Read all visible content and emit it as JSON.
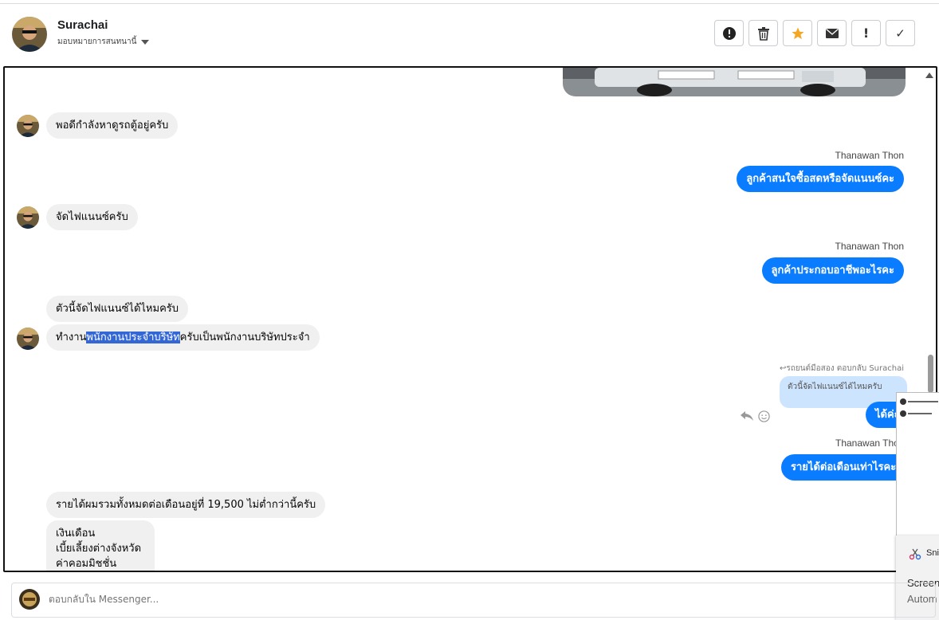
{
  "header": {
    "name": "Surachai",
    "assign_label": "มอบหมายการสนทนานี้",
    "tools": [
      {
        "icon": "spam-alert-icon",
        "glyph": "!"
      },
      {
        "icon": "trash-icon",
        "glyph": ""
      },
      {
        "icon": "star-icon",
        "glyph": "★"
      },
      {
        "icon": "mail-icon",
        "glyph": "✉"
      },
      {
        "icon": "exclamation-icon",
        "glyph": "!"
      },
      {
        "icon": "check-icon",
        "glyph": "✓"
      }
    ]
  },
  "messages": {
    "m1": "พอดีกำลังหาดูรถตู้อยู่ครับ",
    "m2_sender": "Thanawan Thon",
    "m2": "ลูกค้าสนใจซื้อสดหรือจัดแนนซ์คะ",
    "m3": "จัดไฟแนนซ์ครับ",
    "m4_sender": "Thanawan Thon",
    "m4": "ลูกค้าประกอบอาชีพอะไรคะ",
    "m5": "ตัวนี้จัดไฟแนนซ์ได้ไหมครับ",
    "m6_pre": "ทำงาน",
    "m6_hl": "พนักงานประจำบริษัท",
    "m6_post": "ครับเป็นพนักงานบริษัทประจำ",
    "m7_note": "↩รถยนต์มือสอง ตอบกลับ Surachai",
    "m7_quote": "ตัวนี้จัดไฟแนนซ์ได้ไหมครับ",
    "m7": "ได้ค่ะ",
    "m8_sender": "Thanawan Thon",
    "m8": "รายได้ต่อเดือนเท่าไรคะ",
    "m9": "รายได้ผมรวมทั้งหมดต่อเดือนอยู่ที่ 19,500 ไม่ต่ำกว่านี้ครับ",
    "m10_lines": [
      "เงินเดือน",
      "เบี้ยเลี้ยงต่างจังหวัด",
      "ค่าคอมมิชชั่น"
    ]
  },
  "snip": {
    "label": "Sni",
    "title": "Screen",
    "subtitle": "Autom"
  },
  "composer": {
    "placeholder": "ตอบกลับใน Messenger..."
  },
  "colors": {
    "outgoing": "#0a7cff",
    "incoming": "#f0f0f0",
    "highlight": "#3367d6",
    "star": "#f5a623"
  }
}
